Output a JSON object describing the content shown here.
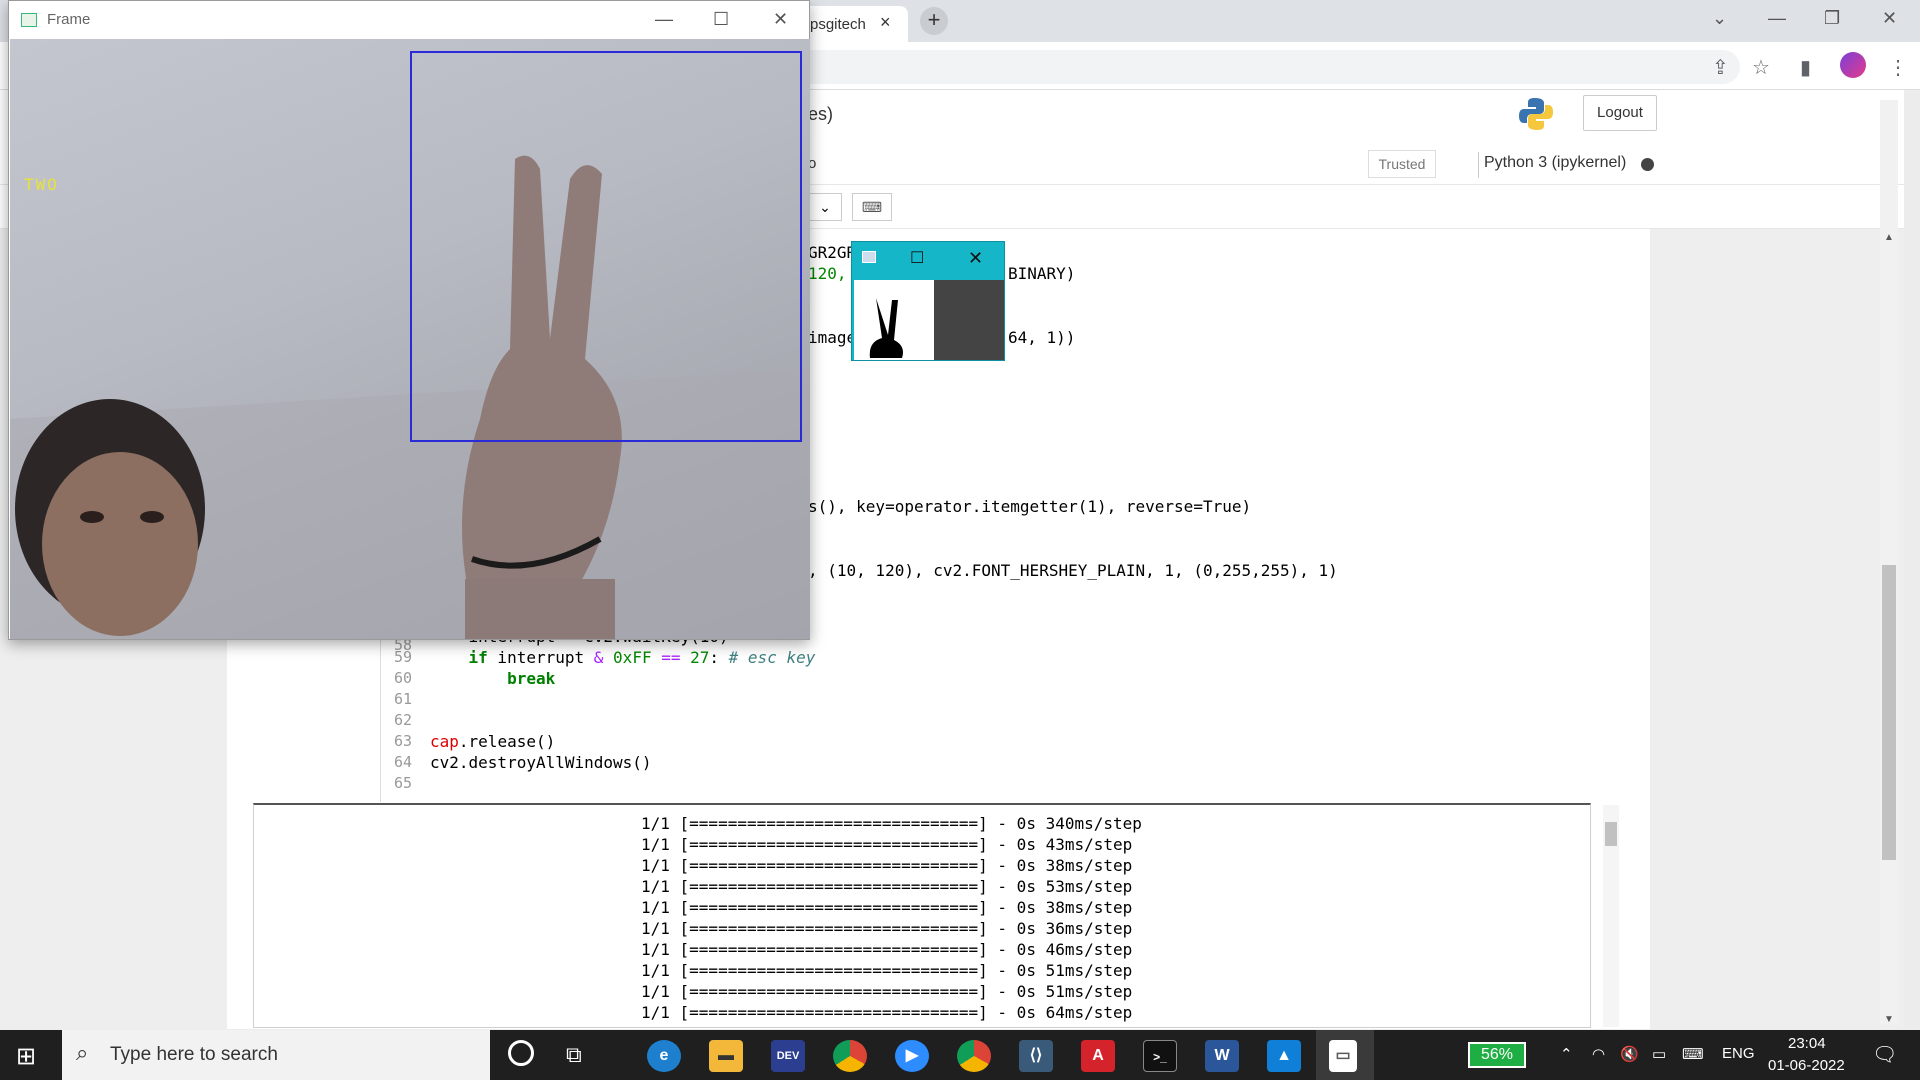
{
  "browser": {
    "tab_title": "psgitech",
    "tab_close": "×",
    "new_tab": "+"
  },
  "jupyter": {
    "title_fragment": "es)",
    "logout_label": "Logout",
    "menu_fragment": "o",
    "trusted_label": "Trusted",
    "kernel_label": "Python 3 (ipykernel)",
    "code_fragments": [
      {
        "text": "GR2GR",
        "top": 0
      },
      {
        "text": "120,",
        "top": 0
      },
      {
        "text": "BINARY)",
        "top": 0
      },
      {
        "text": "image",
        "top": 0
      },
      {
        "text": "64, 1))",
        "top": 0
      },
      {
        "text": ",",
        "top": 0
      },
      {
        "text": "s(), key=operator.itemgetter(1), reverse=True)",
        "top": 0
      },
      {
        "text": ", (10, 120), cv2.FONT_HERSHEY_PLAIN, 1, (0,255,255), 1)",
        "top": 0
      }
    ],
    "code_lines": [
      {
        "no": "58",
        "text": "    interrupt = cv2.waitKey(10)"
      },
      {
        "no": "59",
        "text": "    if interrupt & 0xFF == 27: # esc key"
      },
      {
        "no": "60",
        "text": "        break"
      },
      {
        "no": "61",
        "text": ""
      },
      {
        "no": "62",
        "text": ""
      },
      {
        "no": "63",
        "text": "cap.release()"
      },
      {
        "no": "64",
        "text": "cv2.destroyAllWindows()"
      },
      {
        "no": "65",
        "text": ""
      }
    ],
    "output_lines": [
      "1/1 [==============================] - 0s 340ms/step",
      "1/1 [==============================] - 0s 43ms/step",
      "1/1 [==============================] - 0s 38ms/step",
      "1/1 [==============================] - 0s 53ms/step",
      "1/1 [==============================] - 0s 38ms/step",
      "1/1 [==============================] - 0s 36ms/step",
      "1/1 [==============================] - 0s 46ms/step",
      "1/1 [==============================] - 0s 51ms/step",
      "1/1 [==============================] - 0s 51ms/step",
      "1/1 [==============================] - 0s 64ms/step"
    ]
  },
  "frame_window": {
    "title": "Frame",
    "prediction_label": "TWO"
  },
  "taskbar": {
    "search_placeholder": "Type here to search",
    "battery": "56%",
    "language": "ENG",
    "time": "23:04",
    "date": "01-06-2022",
    "apps": [
      "edge-icon",
      "file-explorer-icon",
      "devcpp-icon",
      "chrome-icon",
      "zoom-icon",
      "chrome-profile-icon",
      "vscode-icon",
      "acrobat-icon",
      "terminal-icon",
      "word-icon",
      "photos-icon",
      "notepad-icon"
    ]
  }
}
